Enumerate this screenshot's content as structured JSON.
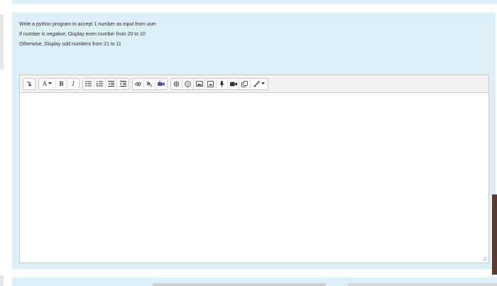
{
  "question": {
    "lines": [
      "Write a python program to accept 1 number as input from user",
      "If number is negative, Display even number from 20 to 10",
      "Otherwise, Display odd numbers from 21 to 11"
    ]
  },
  "toolbar": {
    "font_size_label": "A",
    "bold_label": "B",
    "italic_label": "I",
    "icons": [
      "collapse-icon",
      "font-size-icon",
      "bold-icon",
      "italic-icon",
      "unordered-list-icon",
      "ordered-list-icon",
      "outdent-icon",
      "indent-icon",
      "link-icon",
      "unlink-icon",
      "media-icon",
      "equation-icon",
      "emoji-icon",
      "image-icon",
      "file-icon",
      "microphone-icon",
      "video-icon",
      "copy-icon",
      "paint-brush-icon"
    ]
  },
  "editor": {
    "value": ""
  }
}
